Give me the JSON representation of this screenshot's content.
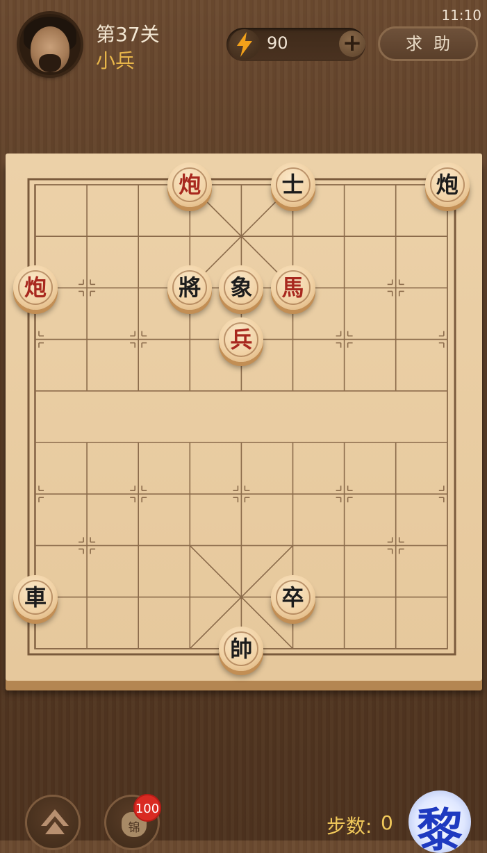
{
  "status_bar": {
    "time": "11:10"
  },
  "header": {
    "level": "第37关",
    "rank": "小兵",
    "energy": "90",
    "help_label": "求助"
  },
  "board": {
    "pieces": [
      {
        "name": "piece-red-cannon-1",
        "char": "炮",
        "color": "red",
        "file": 3,
        "rank": 0
      },
      {
        "name": "piece-black-advisor",
        "char": "士",
        "color": "black",
        "file": 5,
        "rank": 0
      },
      {
        "name": "piece-black-cannon",
        "char": "炮",
        "color": "black",
        "file": 8,
        "rank": 0
      },
      {
        "name": "piece-red-cannon-2",
        "char": "炮",
        "color": "red",
        "file": 0,
        "rank": 2
      },
      {
        "name": "piece-black-general",
        "char": "將",
        "color": "black",
        "file": 3,
        "rank": 2
      },
      {
        "name": "piece-black-elephant",
        "char": "象",
        "color": "black",
        "file": 4,
        "rank": 2
      },
      {
        "name": "piece-red-horse",
        "char": "馬",
        "color": "red",
        "file": 5,
        "rank": 2
      },
      {
        "name": "piece-red-soldier",
        "char": "兵",
        "color": "red",
        "file": 4,
        "rank": 3
      },
      {
        "name": "piece-black-chariot",
        "char": "車",
        "color": "black",
        "file": 0,
        "rank": 8
      },
      {
        "name": "piece-black-soldier",
        "char": "卒",
        "color": "black",
        "file": 5,
        "rank": 8
      },
      {
        "name": "piece-red-general",
        "char": "帥",
        "color": "black",
        "file": 4,
        "rank": 9
      }
    ]
  },
  "footer": {
    "coins_badge": "100",
    "bag_label": "锦",
    "steps_label": "步数:",
    "steps_value": "0",
    "opponent_char": "黎"
  }
}
